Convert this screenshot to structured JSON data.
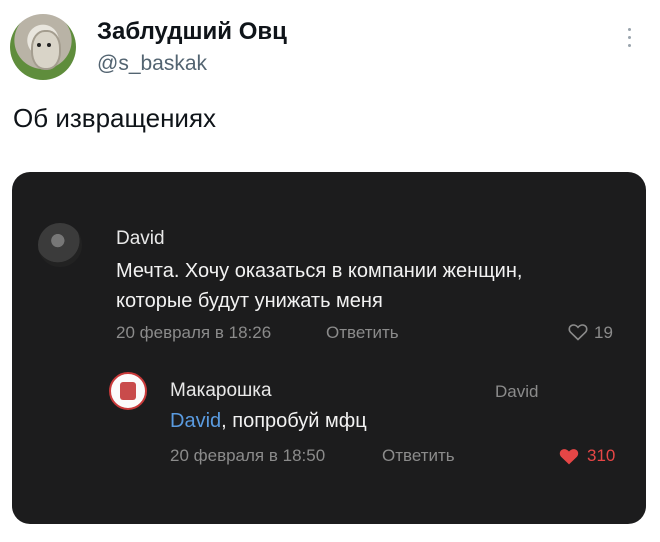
{
  "tweet": {
    "author_name": "Заблудший Овц",
    "author_handle": "@s_baskak",
    "text": "Об извращениях",
    "more_icon": "more-vertical-icon"
  },
  "screenshot": {
    "comments": [
      {
        "author": "David",
        "text_line1": "Мечта. Хочу оказаться в компании женщин,",
        "text_line2": "которые будут унижать меня",
        "date": "20 февраля в 18:26",
        "reply_label": "Ответить",
        "likes": "19",
        "liked": false
      },
      {
        "author": "Макарошка",
        "reply_to": "David",
        "mention": "David",
        "text_rest": ", попробуй мфц",
        "date": "20 февраля в 18:50",
        "reply_label": "Ответить",
        "likes": "310",
        "liked": true,
        "liked_color": "#e64646"
      }
    ]
  },
  "colors": {
    "card_bg": "#1c1c1d",
    "mention": "#5a9be0",
    "heart_liked": "#e64646"
  }
}
